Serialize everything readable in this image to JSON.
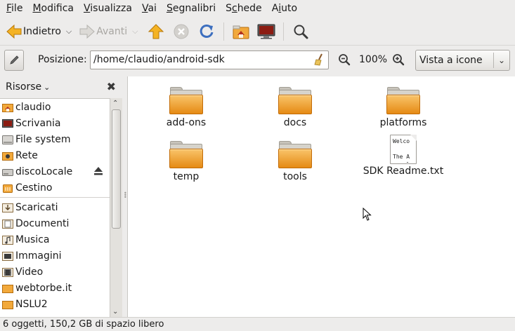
{
  "menubar": {
    "items": [
      {
        "pre": "",
        "u": "F",
        "post": "ile"
      },
      {
        "pre": "",
        "u": "M",
        "post": "odifica"
      },
      {
        "pre": "",
        "u": "V",
        "post": "isualizza"
      },
      {
        "pre": "",
        "u": "V",
        "post": "ai"
      },
      {
        "pre": "",
        "u": "S",
        "post": "egnalibri"
      },
      {
        "pre": "S",
        "u": "c",
        "post": "hede"
      },
      {
        "pre": "A",
        "u": "i",
        "post": "uto"
      }
    ]
  },
  "toolbar": {
    "back_label": "Indietro",
    "forward_label": "Avanti"
  },
  "location": {
    "label": "Posizione:",
    "path": "/home/claudio/android-sdk",
    "zoom": "100%",
    "view_mode": "Vista a icone"
  },
  "sidebar": {
    "header": "Risorse",
    "places": [
      {
        "label": "claudio",
        "icon": "home-folder-icon"
      },
      {
        "label": "Scrivania",
        "icon": "desktop-icon"
      },
      {
        "label": "File system",
        "icon": "harddisk-icon"
      },
      {
        "label": "Rete",
        "icon": "network-icon"
      },
      {
        "label": "discoLocale",
        "icon": "drive-icon"
      },
      {
        "label": "Cestino",
        "icon": "trash-icon"
      }
    ],
    "bookmarks": [
      {
        "label": "Scaricati",
        "icon": "downloads-folder-icon"
      },
      {
        "label": "Documenti",
        "icon": "documents-folder-icon"
      },
      {
        "label": "Musica",
        "icon": "music-folder-icon"
      },
      {
        "label": "Immagini",
        "icon": "pictures-folder-icon"
      },
      {
        "label": "Video",
        "icon": "video-folder-icon"
      },
      {
        "label": "webtorbe.it",
        "icon": "folder-icon"
      },
      {
        "label": "NSLU2",
        "icon": "folder-icon"
      }
    ]
  },
  "files": [
    {
      "name": "add-ons",
      "type": "folder"
    },
    {
      "name": "docs",
      "type": "folder"
    },
    {
      "name": "platforms",
      "type": "folder"
    },
    {
      "name": "temp",
      "type": "folder"
    },
    {
      "name": "tools",
      "type": "folder"
    },
    {
      "name": "SDK Readme.txt",
      "type": "text",
      "preview": "Welco\n\nThe A\npopul"
    }
  ],
  "status": {
    "text": "6 oggetti, 150,2 GB di spazio libero"
  },
  "colors": {
    "folder_light": "#f9c46a",
    "folder_dark": "#e58a14",
    "accent": "#3d6fbf"
  }
}
